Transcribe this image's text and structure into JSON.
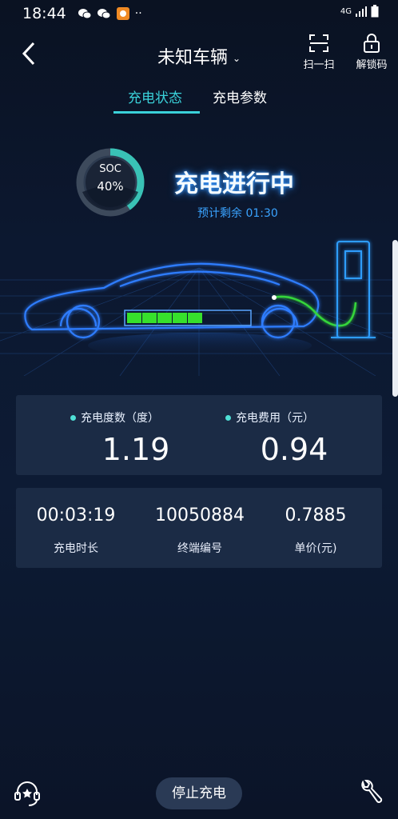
{
  "status_bar": {
    "time": "18:44",
    "network": "4G",
    "icons": [
      "wechat-icon",
      "wechat-icon",
      "app-icon",
      "more-dots-icon"
    ]
  },
  "nav": {
    "title": "未知车辆",
    "scan_label": "扫一扫",
    "unlock_label": "解锁码"
  },
  "tabs": [
    {
      "label": "充电状态"
    },
    {
      "label": "充电参数"
    }
  ],
  "soc": {
    "label": "SOC",
    "value": "40%",
    "percent": 40
  },
  "charging": {
    "status": "充电进行中",
    "remaining_prefix": "预计剩余",
    "remaining_time": "01:30"
  },
  "summary": {
    "energy_label": "充电度数（度）",
    "energy_value": "1.19",
    "cost_label": "充电费用（元）",
    "cost_value": "0.94"
  },
  "details": [
    {
      "value": "00:03:19",
      "label": "充电时长"
    },
    {
      "value": "10050884",
      "label": "终端编号"
    },
    {
      "value": "0.7885",
      "label": "单价(元)"
    }
  ],
  "bottom": {
    "stop_label": "停止充电"
  },
  "colors": {
    "accent": "#3ad1d9",
    "card": "#1b2b45",
    "battery": "#37e02c",
    "car_glow": "#2f7dff"
  }
}
